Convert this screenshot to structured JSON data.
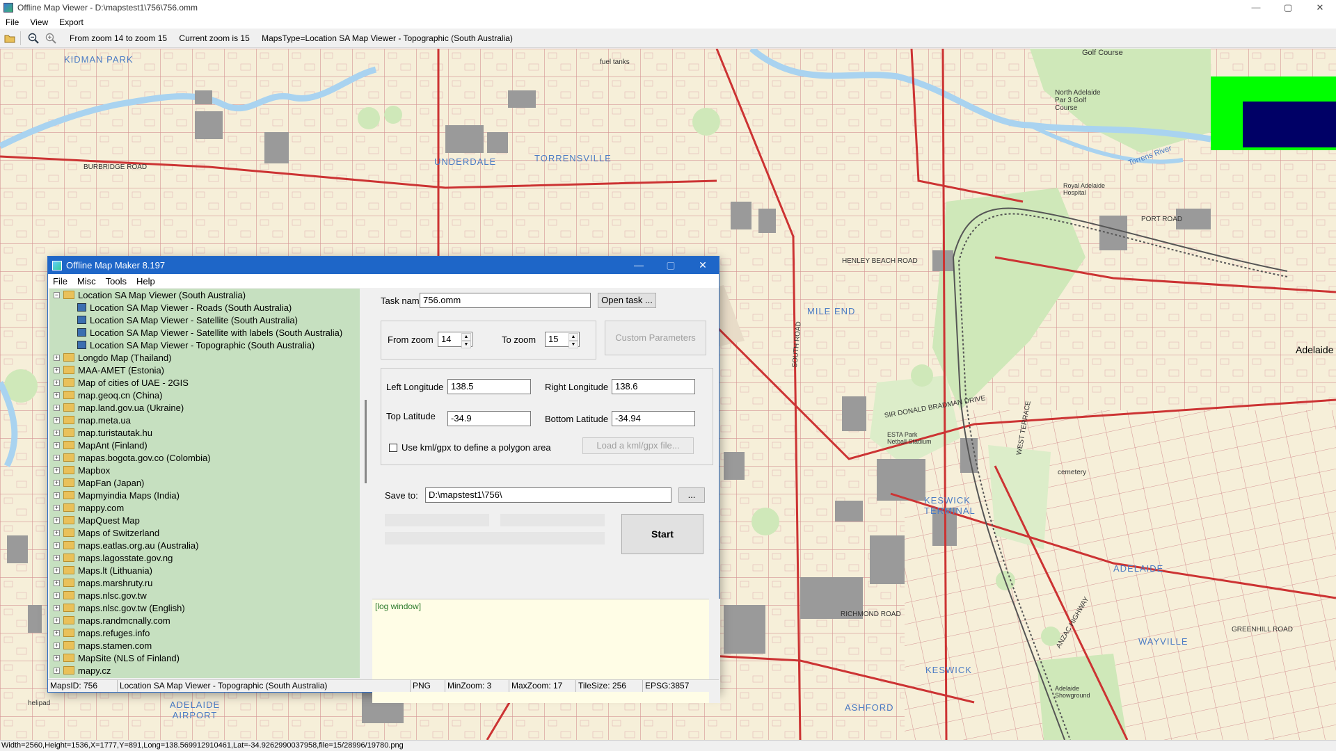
{
  "window": {
    "title": "Offline Map Viewer - D:\\mapstest1\\756\\756.omm",
    "controls": [
      "—",
      "▢",
      "✕"
    ]
  },
  "menu": [
    "File",
    "View",
    "Export"
  ],
  "toolbar": {
    "zoom_range": "From zoom 14 to zoom 15",
    "current_zoom": "Current zoom is 15",
    "maps_type": "MapsType=Location SA Map Viewer - Topographic (South Australia)"
  },
  "map": {
    "suburbs": [
      "UNDERDALE",
      "TORRENSVILLE",
      "MILE END",
      "KESWICK TERMINAL",
      "ADELAIDE",
      "WAYVILLE",
      "ASHFORD",
      "KESWICK",
      "KIDMAN PARK",
      "ADELAIDE AIRPORT"
    ],
    "labels": [
      "Golf Course",
      "North Adelaide Par 3 Golf Course",
      "Adelaide",
      "Royal Adelaide Hospital",
      "Torrens River",
      "ESTA Park Netball Stadium",
      "cemetery",
      "Adelaide Showground",
      "helipad",
      "fuel tanks",
      "BURBRIDGE ROAD",
      "SOUTH ROAD",
      "SIR DONALD BRADMAN DRIVE",
      "GREENHILL ROAD",
      "WEST TERRACE",
      "ANZAC HIGHWAY",
      "HENLEY BEACH ROAD",
      "PORT ROAD",
      "RICHMOND ROAD"
    ],
    "colors": {
      "background": "#f6efd9",
      "roads": "#cc3333",
      "water": "#a9d3f0",
      "park": "#cfe8b9",
      "buildings": "#9a9a9a"
    }
  },
  "statusbar": "Width=2560,Height=1536,X=1777,Y=891,Long=138.569912910461,Lat=-34.9262990037958,file=15/28996/19780.png",
  "dialog": {
    "title": "Offline Map Maker 8.197",
    "controls": [
      "—",
      "▢",
      "✕"
    ],
    "menu": [
      "File",
      "Misc",
      "Tools",
      "Help"
    ],
    "tree": {
      "root": "Location SA Map Viewer (South Australia)",
      "children": [
        "Location SA Map Viewer - Roads (South Australia)",
        "Location SA Map Viewer - Satellite (South Australia)",
        "Location SA Map Viewer - Satellite with labels (South Australia)",
        "Location SA Map Viewer - Topographic (South Australia)"
      ],
      "items": [
        "Longdo Map (Thailand)",
        "MAA-AMET (Estonia)",
        "Map of cities of UAE - 2GIS",
        "map.geoq.cn (China)",
        "map.land.gov.ua (Ukraine)",
        "map.meta.ua",
        "map.turistautak.hu",
        "MapAnt (Finland)",
        "mapas.bogota.gov.co (Colombia)",
        "Mapbox",
        "MapFan (Japan)",
        "Mapmyindia Maps (India)",
        "mappy.com",
        "MapQuest Map",
        "Maps of Switzerland",
        "maps.eatlas.org.au (Australia)",
        "maps.lagosstate.gov.ng",
        "Maps.lt (Lithuania)",
        "maps.marshruty.ru",
        "maps.nlsc.gov.tw",
        "maps.nlsc.gov.tw (English)",
        "maps.randmcnally.com",
        "maps.refuges.info",
        "maps.stamen.com",
        "MapSite (NLS of Finland)",
        "mapy.cz"
      ]
    },
    "form": {
      "task_name_label": "Task name",
      "task_name_value": "756.omm",
      "open_task": "Open task ...",
      "from_zoom_label": "From zoom",
      "from_zoom_value": "14",
      "to_zoom_label": "To zoom",
      "to_zoom_value": "15",
      "custom_params": "Custom Parameters",
      "left_long_label": "Left Longitude",
      "left_long_value": "138.5",
      "right_long_label": "Right Longitude",
      "right_long_value": "138.6",
      "top_lat_label": "Top Latitude",
      "top_lat_value": "-34.9",
      "bottom_lat_label": "Bottom Latitude",
      "bottom_lat_value": "-34.94",
      "kml_label": "Use kml/gpx to define a polygon area",
      "kml_button": "Load a kml/gpx file...",
      "save_to_label": "Save to:",
      "save_to_value": "D:\\mapstest1\\756\\",
      "browse": "...",
      "start": "Start",
      "log": "[log window]"
    },
    "status": {
      "maps_id": "MapsID: 756",
      "name": "Location SA Map Viewer - Topographic (South Australia)",
      "format": "PNG",
      "min_zoom": "MinZoom: 3",
      "max_zoom": "MaxZoom: 17",
      "tile_size": "TileSize: 256",
      "epsg": "EPSG:3857"
    }
  }
}
